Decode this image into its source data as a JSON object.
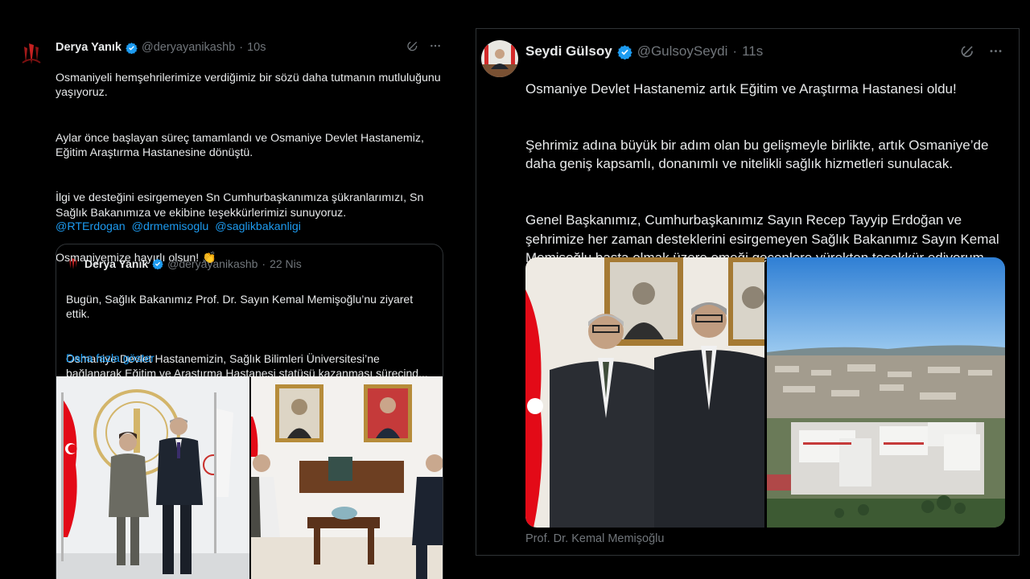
{
  "colors": {
    "background": "#000000",
    "text_primary": "#e7e9ea",
    "text_secondary": "#71767b",
    "link": "#1d9bf0",
    "border": "#2f3336",
    "verified": "#1d9bf0"
  },
  "left_tweet": {
    "author_name": "Derya Yanık",
    "handle": "@deryayanikashb",
    "separator": "·",
    "time": "10s",
    "paragraphs": [
      "Osmaniyeli hemşehrilerimize verdiğimiz bir sözü daha tutmanın mutluluğunu yaşıyoruz.",
      "Aylar önce başlayan süreç tamamlandı ve Osmaniye Devlet Hastanemiz, Eğitim Araştırma Hastanesine dönüştü.",
      "İlgi ve desteğini esirgemeyen Sn Cumhurbaşkanımıza şükranlarımızı, Sn Sağlık Bakanımıza ve ekibine teşekkürlerimizi sunuyoruz.",
      "Osmaniyemize hayırlı olsun! 👏"
    ],
    "mentions": [
      "@RTErdogan",
      "@drmemisoglu",
      "@saglikbakanligi"
    ],
    "icons": [
      "grok-icon",
      "more-icon"
    ],
    "quote": {
      "author_name": "Derya Yanık",
      "handle": "@deryayanikashb",
      "separator": "·",
      "time": "22 Nis",
      "paragraphs": [
        "Bugün, Sağlık Bakanımız Prof. Dr. Sayın Kemal Memişoğlu’nu ziyaret ettik.",
        "Osmaniye Devlet Hastanemizin, Sağlık Bilimleri Üniversitesi’ne bağlanarak Eğitim ve Araştırma Hastanesi statüsü kazanması sürecind..."
      ],
      "show_more": "Daha fazla göster"
    }
  },
  "right_tweet": {
    "author_name": "Seydi Gülsoy",
    "handle": "@GulsoySeydi",
    "separator": "·",
    "time": "11s",
    "paragraphs": [
      "Osmaniye Devlet Hastanemiz artık Eğitim ve Araştırma Hastanesi oldu!",
      "Şehrimiz adına büyük bir adım olan bu gelişmeyle birlikte, artık Osmaniye’de daha geniş kapsamlı, donanımlı ve nitelikli sağlık hizmetleri sunulacak.",
      "Genel Başkanımız, Cumhurbaşkanımız Sayın Recep Tayyip Erdoğan ve şehrimize her zaman desteklerini esirgemeyen Sağlık Bakanımız Sayın Kemal Memişoğlu başta olmak üzere emeği geçenlere yürekten teşekkür ediyorum."
    ],
    "media_caption": "Prof. Dr. Kemal Memişoğlu",
    "icons": [
      "grok-icon",
      "more-icon"
    ]
  }
}
